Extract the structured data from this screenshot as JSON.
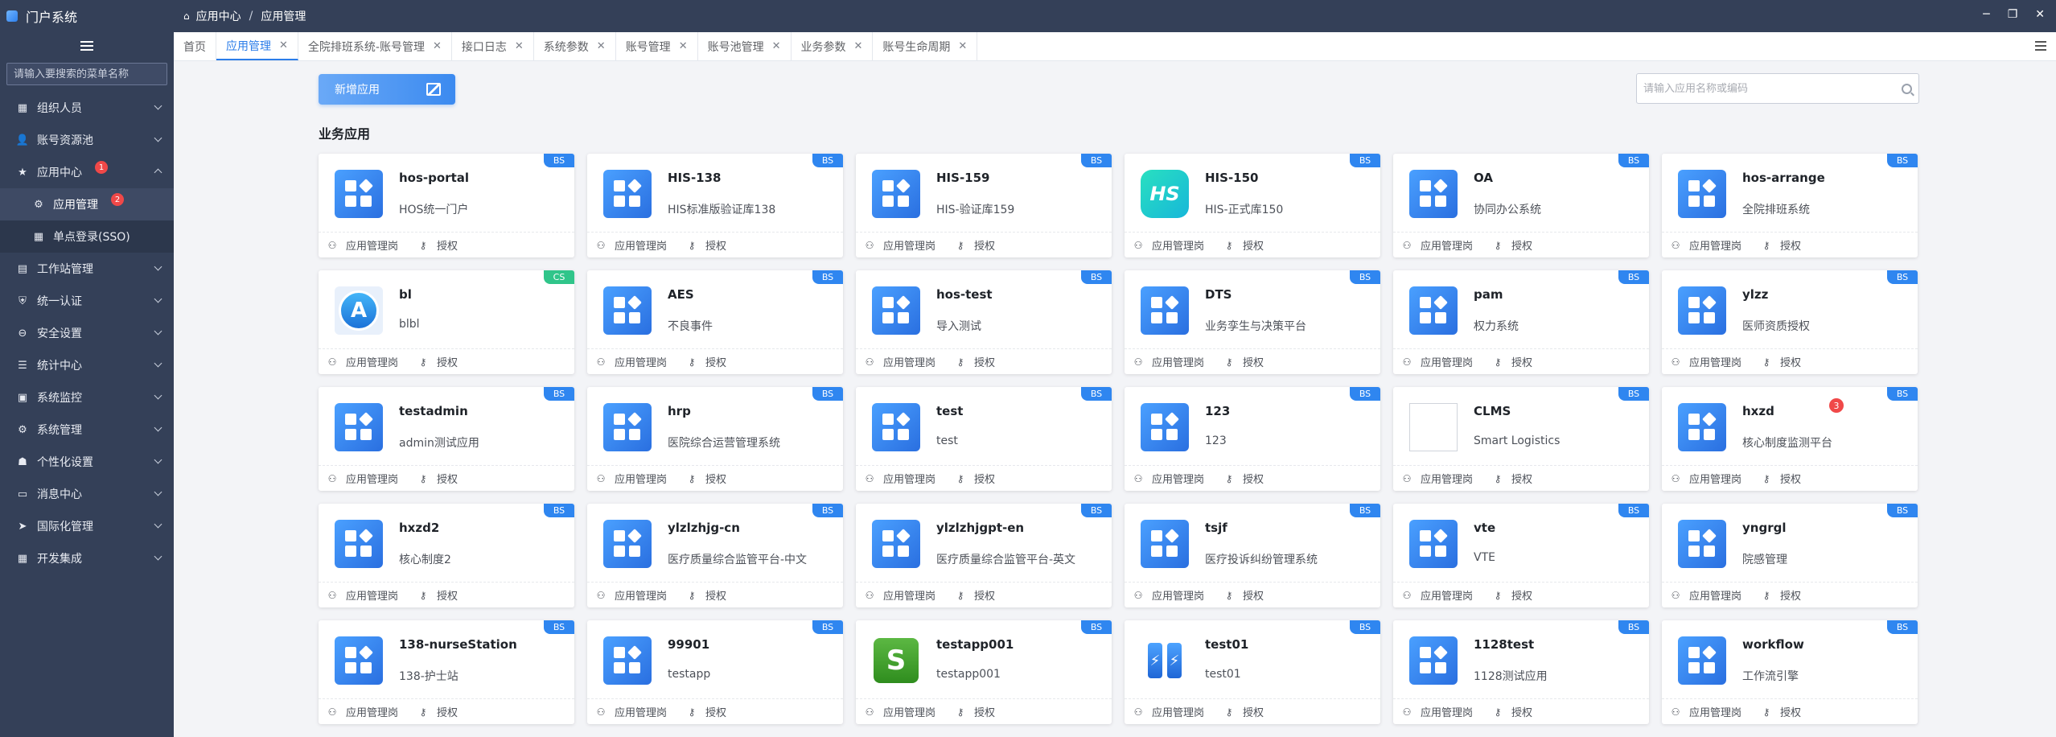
{
  "app": {
    "title": "门户系统",
    "breadcrumb": [
      "应用中心",
      "应用管理"
    ],
    "window_controls": [
      "─",
      "❐",
      "✕"
    ]
  },
  "sidebar": {
    "search_placeholder": "请输入要搜索的菜单名称",
    "items": [
      {
        "label": "组织人员",
        "icon": "org-icon",
        "glyph": "▦"
      },
      {
        "label": "账号资源池",
        "icon": "account-icon",
        "glyph": "👤"
      },
      {
        "label": "应用中心",
        "icon": "star-icon",
        "glyph": "★",
        "badge": "1",
        "expanded": true,
        "children": [
          {
            "label": "应用管理",
            "icon": "gear-icon",
            "glyph": "⚙",
            "badge": "2",
            "active": true
          },
          {
            "label": "单点登录(SSO)",
            "icon": "grid-icon",
            "glyph": "▦"
          }
        ]
      },
      {
        "label": "工作站管理",
        "icon": "workstation-icon",
        "glyph": "▤"
      },
      {
        "label": "统一认证",
        "icon": "shield-icon",
        "glyph": "⛨"
      },
      {
        "label": "安全设置",
        "icon": "lock-icon",
        "glyph": "⊖"
      },
      {
        "label": "统计中心",
        "icon": "list-icon",
        "glyph": "☰"
      },
      {
        "label": "系统监控",
        "icon": "monitor-icon",
        "glyph": "▣"
      },
      {
        "label": "系统管理",
        "icon": "settings-icon",
        "glyph": "⚙"
      },
      {
        "label": "个性化设置",
        "icon": "person-icon",
        "glyph": "☗"
      },
      {
        "label": "消息中心",
        "icon": "message-icon",
        "glyph": "▭"
      },
      {
        "label": "国际化管理",
        "icon": "send-icon",
        "glyph": "➤"
      },
      {
        "label": "开发集成",
        "icon": "dev-icon",
        "glyph": "▦"
      }
    ]
  },
  "tabs": [
    {
      "label": "首页",
      "closable": false
    },
    {
      "label": "应用管理",
      "closable": true,
      "active": true
    },
    {
      "label": "全院排班系统-账号管理",
      "closable": true
    },
    {
      "label": "接口日志",
      "closable": true
    },
    {
      "label": "系统参数",
      "closable": true
    },
    {
      "label": "账号管理",
      "closable": true
    },
    {
      "label": "账号池管理",
      "closable": true
    },
    {
      "label": "业务参数",
      "closable": true
    },
    {
      "label": "账号生命周期",
      "closable": true
    }
  ],
  "main": {
    "add_button": "新增应用",
    "search_placeholder": "请输入应用名称或编码",
    "section_title": "业务应用",
    "action_manage": "应用管理岗",
    "action_auth": "授权"
  },
  "apps": [
    {
      "name": "hos-portal",
      "desc": "HOS统一门户",
      "tag": "BS",
      "icon": "tile"
    },
    {
      "name": "HIS-138",
      "desc": "HIS标准版验证库138",
      "tag": "BS",
      "icon": "tile"
    },
    {
      "name": "HIS-159",
      "desc": "HIS-验证库159",
      "tag": "BS",
      "icon": "tile"
    },
    {
      "name": "HIS-150",
      "desc": "HIS-正式库150",
      "tag": "BS",
      "icon": "his"
    },
    {
      "name": "OA",
      "desc": "协同办公系统",
      "tag": "BS",
      "icon": "tile"
    },
    {
      "name": "hos-arrange",
      "desc": "全院排班系统",
      "tag": "BS",
      "icon": "tile"
    },
    {
      "name": "bl",
      "desc": "blbl",
      "tag": "CS",
      "icon": "store"
    },
    {
      "name": "AES",
      "desc": "不良事件",
      "tag": "BS",
      "icon": "tile"
    },
    {
      "name": "hos-test",
      "desc": "导入测试",
      "tag": "BS",
      "icon": "tile"
    },
    {
      "name": "DTS",
      "desc": "业务孪生与决策平台",
      "tag": "BS",
      "icon": "tile"
    },
    {
      "name": "pam",
      "desc": "权力系统",
      "tag": "BS",
      "icon": "tile"
    },
    {
      "name": "ylzz",
      "desc": "医师资质授权",
      "tag": "BS",
      "icon": "tile"
    },
    {
      "name": "testadmin",
      "desc": "admin测试应用",
      "tag": "BS",
      "icon": "tile"
    },
    {
      "name": "hrp",
      "desc": "医院综合运营管理系统",
      "tag": "BS",
      "icon": "tile"
    },
    {
      "name": "test",
      "desc": "test",
      "tag": "BS",
      "icon": "tile"
    },
    {
      "name": "123",
      "desc": "123",
      "tag": "BS",
      "icon": "tile"
    },
    {
      "name": "CLMS",
      "desc": "Smart Logistics",
      "tag": "BS",
      "icon": "broken"
    },
    {
      "name": "hxzd",
      "desc": "核心制度监测平台",
      "tag": "BS",
      "icon": "tile",
      "badge": "3"
    },
    {
      "name": "hxzd2",
      "desc": "核心制度2",
      "tag": "BS",
      "icon": "tile"
    },
    {
      "name": "ylzlzhjg-cn",
      "desc": "医疗质量综合监管平台-中文",
      "tag": "BS",
      "icon": "tile"
    },
    {
      "name": "ylzlzhjgpt-en",
      "desc": "医疗质量综合监管平台-英文",
      "tag": "BS",
      "icon": "tile"
    },
    {
      "name": "tsjf",
      "desc": "医疗投诉纠纷管理系统",
      "tag": "BS",
      "icon": "tile"
    },
    {
      "name": "vte",
      "desc": "VTE",
      "tag": "BS",
      "icon": "tile"
    },
    {
      "name": "yngrgl",
      "desc": "院感管理",
      "tag": "BS",
      "icon": "tile"
    },
    {
      "name": "138-nurseStation",
      "desc": "138-护士站",
      "tag": "BS",
      "icon": "tile"
    },
    {
      "name": "99901",
      "desc": "testapp",
      "tag": "BS",
      "icon": "tile"
    },
    {
      "name": "testapp001",
      "desc": "testapp001",
      "tag": "BS",
      "icon": "green"
    },
    {
      "name": "test01",
      "desc": "test01",
      "tag": "BS",
      "icon": "shoes"
    },
    {
      "name": "1128test",
      "desc": "1128测试应用",
      "tag": "BS",
      "icon": "tile"
    },
    {
      "name": "workflow",
      "desc": "工作流引擎",
      "tag": "BS",
      "icon": "tile"
    }
  ],
  "colors": {
    "sidebar_bg": "#344058",
    "accent": "#2f86f0",
    "tag_cs": "#30c58a",
    "badge": "#f04848"
  }
}
